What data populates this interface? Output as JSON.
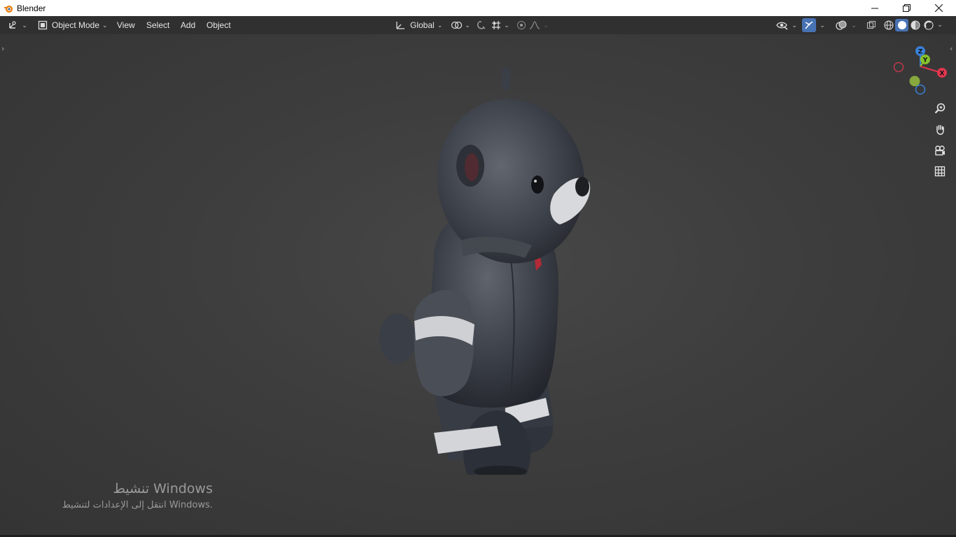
{
  "window": {
    "title": "Blender",
    "controls": [
      "minimize-icon",
      "restore-icon",
      "close-icon"
    ]
  },
  "header": {
    "editor_type_icon": "editor-type-3d-viewport-icon",
    "mode": "Object Mode",
    "menus": [
      "View",
      "Select",
      "Add",
      "Object"
    ],
    "transform_orientation": "Global",
    "pivot_icon": "pivot-point-icon",
    "snap_icon": "snap-magnet-icon",
    "proportional_icon": "proportional-editing-icon",
    "visibility_icon": "selectability-visibility-icon",
    "gizmo_icon": "gizmo-toggle-icon",
    "overlay_icon": "overlay-toggle-icon",
    "xray_icon": "xray-toggle-icon",
    "shading_modes": [
      "wireframe",
      "solid",
      "material-preview",
      "rendered"
    ],
    "shading_active": "solid"
  },
  "viewport": {
    "gizmo_axes": [
      "X",
      "Y",
      "Z"
    ],
    "nav_buttons": [
      "zoom-icon",
      "pan-hand-icon",
      "camera-view-icon",
      "orthographic-grid-icon"
    ],
    "model": "teddy-bear-in-suit"
  },
  "activation": {
    "title": "تنشيط Windows",
    "subtitle": "انتقل إلى الإعدادات لتنشيط Windows."
  },
  "colors": {
    "accent": "#4772b3",
    "axis_x": "#e0374f",
    "axis_y": "#86c12c",
    "axis_z": "#3a80d8"
  }
}
